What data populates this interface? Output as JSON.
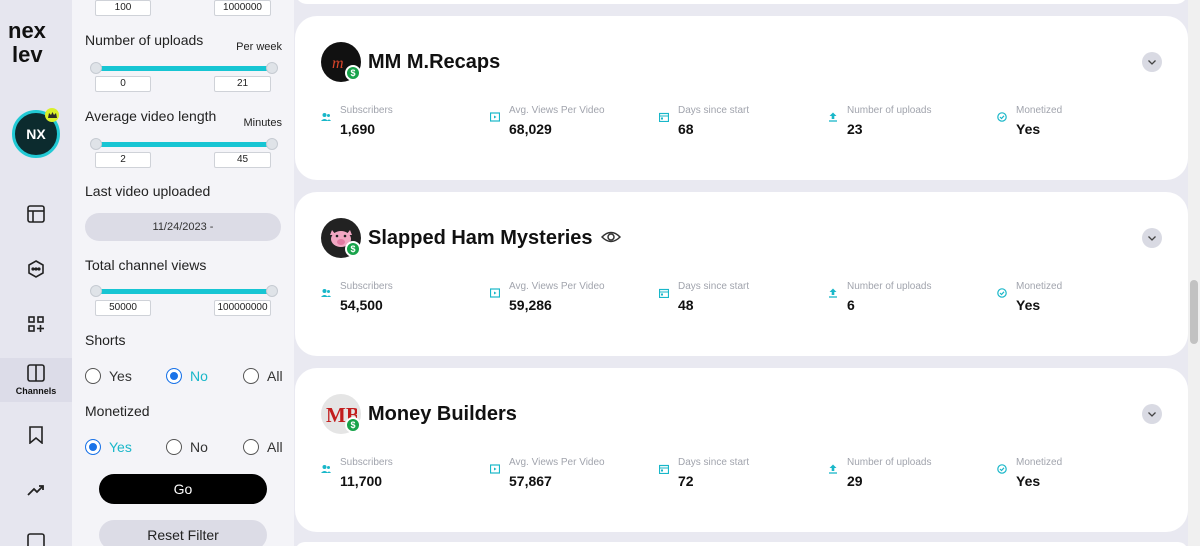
{
  "brand": {
    "logo_text": "nexlev"
  },
  "rail": {
    "avatar_initials": "NX",
    "items": [
      {
        "name": "layout",
        "label": ""
      },
      {
        "name": "chat",
        "label": ""
      },
      {
        "name": "apps",
        "label": ""
      },
      {
        "name": "channels",
        "label": "Channels"
      },
      {
        "name": "bookmark",
        "label": ""
      },
      {
        "name": "trending",
        "label": ""
      },
      {
        "name": "more",
        "label": ""
      }
    ]
  },
  "filters": {
    "top_range": {
      "min": "100",
      "max": "1000000"
    },
    "uploads": {
      "label": "Number of uploads",
      "unit": "Per week",
      "min": "0",
      "max": "21"
    },
    "video_length": {
      "label": "Average video length",
      "unit": "Minutes",
      "min": "2",
      "max": "45"
    },
    "last_uploaded": {
      "label": "Last video uploaded",
      "value": "11/24/2023 -"
    },
    "total_views": {
      "label": "Total channel views",
      "min": "50000",
      "max": "100000000"
    },
    "shorts": {
      "label": "Shorts",
      "options": [
        "Yes",
        "No",
        "All"
      ],
      "selected": "No"
    },
    "monetized": {
      "label": "Monetized",
      "options": [
        "Yes",
        "No",
        "All"
      ],
      "selected": "Yes"
    },
    "go_label": "Go",
    "reset_label": "Reset Filter"
  },
  "stat_labels": {
    "subscribers": "Subscribers",
    "avg_views": "Avg. Views Per Video",
    "days": "Days since start",
    "uploads": "Number of uploads",
    "monetized": "Monetized"
  },
  "channels": [
    {
      "name": "MM M.Recaps",
      "subscribers": "1,690",
      "avg_views": "68,029",
      "days": "68",
      "uploads": "23",
      "monetized": "Yes"
    },
    {
      "name": "Slapped Ham Mysteries",
      "subscribers": "54,500",
      "avg_views": "59,286",
      "days": "48",
      "uploads": "6",
      "monetized": "Yes"
    },
    {
      "name": "Money Builders",
      "subscribers": "11,700",
      "avg_views": "57,867",
      "days": "72",
      "uploads": "29",
      "monetized": "Yes"
    }
  ],
  "colors": {
    "accent": "#17c5d3",
    "monetized_badge": "#17a34a",
    "primary_button": "#000000"
  }
}
